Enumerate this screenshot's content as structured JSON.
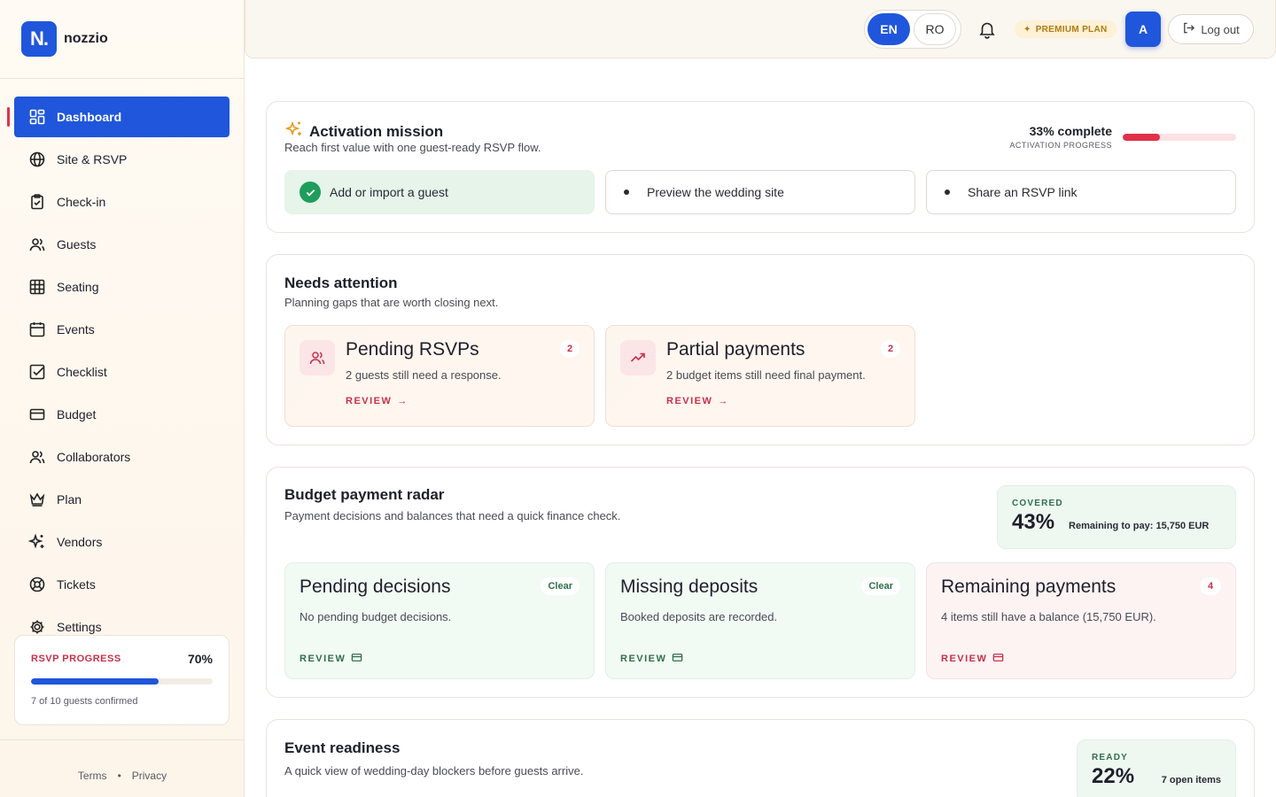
{
  "brand": {
    "logo_text": "N.",
    "name": "nozzio"
  },
  "sidebar": {
    "items": [
      {
        "label": "Dashboard",
        "icon": "dashboard-icon",
        "active": true
      },
      {
        "label": "Site & RSVP",
        "icon": "globe-icon"
      },
      {
        "label": "Check-in",
        "icon": "clipboard-check-icon"
      },
      {
        "label": "Guests",
        "icon": "users-icon"
      },
      {
        "label": "Seating",
        "icon": "grid-icon"
      },
      {
        "label": "Events",
        "icon": "calendar-icon"
      },
      {
        "label": "Checklist",
        "icon": "checkbox-icon"
      },
      {
        "label": "Budget",
        "icon": "wallet-icon"
      },
      {
        "label": "Collaborators",
        "icon": "users-icon"
      },
      {
        "label": "Plan",
        "icon": "crown-icon"
      },
      {
        "label": "Vendors",
        "icon": "sparkles-icon"
      },
      {
        "label": "Tickets",
        "icon": "lifebuoy-icon"
      },
      {
        "label": "Settings",
        "icon": "gear-icon"
      }
    ],
    "rsvp": {
      "label": "RSVP PROGRESS",
      "percent_label": "70%",
      "progress": 0.7,
      "subtitle": "7 of 10 guests confirmed"
    },
    "footer": {
      "terms": "Terms",
      "separator": "•",
      "privacy": "Privacy"
    }
  },
  "header": {
    "lang_active": "EN",
    "lang_other": "RO",
    "premium": "PREMIUM PLAN",
    "avatar": "A",
    "logout": "Log out"
  },
  "activation": {
    "title": "Activation mission",
    "subtitle": "Reach first value with one guest-ready RSVP flow.",
    "progress_label": "33% complete",
    "progress_caption": "ACTIVATION PROGRESS",
    "progress": 0.33,
    "steps": [
      {
        "label": "Add or import a guest",
        "done": true
      },
      {
        "label": "Preview the wedding site",
        "done": false
      },
      {
        "label": "Share an RSVP link",
        "done": false
      }
    ]
  },
  "attention": {
    "title": "Needs attention",
    "subtitle": "Planning gaps that are worth closing next.",
    "items": [
      {
        "title": "Pending RSVPs",
        "badge": "2",
        "desc": "2 guests still need a response.",
        "action": "REVIEW",
        "icon": "users-icon"
      },
      {
        "title": "Partial payments",
        "badge": "2",
        "desc": "2 budget items still need final payment.",
        "action": "REVIEW",
        "icon": "trending-up-icon"
      }
    ]
  },
  "budget": {
    "title": "Budget payment radar",
    "subtitle": "Payment decisions and balances that need a quick finance check.",
    "covered_label": "COVERED",
    "covered_pct": "43%",
    "remaining": "Remaining to pay: 15,750 EUR",
    "items": [
      {
        "title": "Pending decisions",
        "badge": "Clear",
        "desc": "No pending budget decisions.",
        "action": "REVIEW"
      },
      {
        "title": "Missing deposits",
        "badge": "Clear",
        "desc": "Booked deposits are recorded.",
        "action": "REVIEW"
      },
      {
        "title": "Remaining payments",
        "badge": "4",
        "desc": "4 items still have a balance (15,750 EUR).",
        "action": "REVIEW"
      }
    ]
  },
  "event": {
    "title": "Event readiness",
    "subtitle": "A quick view of wedding-day blockers before guests arrive.",
    "ready_label": "READY",
    "ready_pct": "22%",
    "open_items": "7 open items"
  },
  "colors": {
    "accent": "#1f56db",
    "alert": "#e0314a",
    "success": "#1e9e5a"
  }
}
